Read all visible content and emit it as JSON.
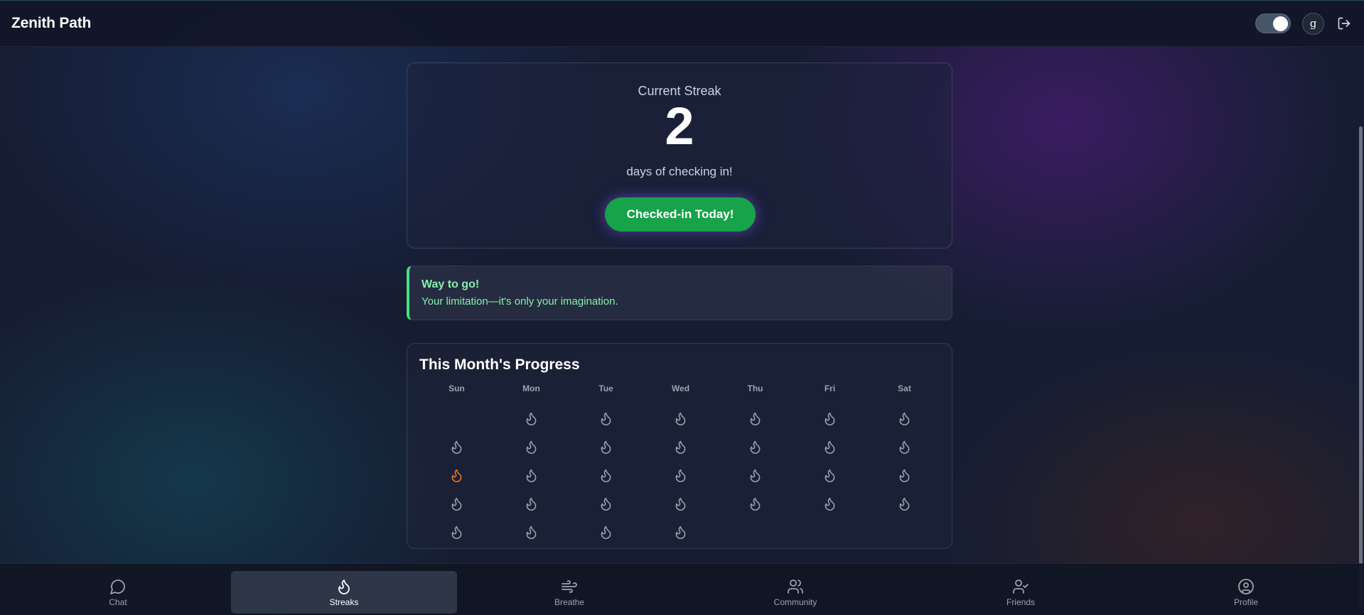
{
  "app": {
    "title": "Zenith Path"
  },
  "header": {
    "avatar_letter": "g",
    "theme_toggle": "on"
  },
  "streak": {
    "label": "Current Streak",
    "count": "2",
    "subtitle": "days of checking in!",
    "button_label": "Checked-in Today!"
  },
  "motivation": {
    "title": "Way to go!",
    "text": "Your limitation—it's only your imagination."
  },
  "progress": {
    "title": "This Month's Progress",
    "weekdays": [
      "Sun",
      "Mon",
      "Tue",
      "Wed",
      "Thu",
      "Fri",
      "Sat"
    ],
    "leading_blank_days": 1,
    "total_days": 31,
    "checked_in_days": [
      14
    ],
    "colors": {
      "inactive": "#9ca3af",
      "active": "#f97316"
    }
  },
  "nav": {
    "items": [
      {
        "label": "Chat",
        "icon": "chat-icon",
        "active": false
      },
      {
        "label": "Streaks",
        "icon": "flame-icon",
        "active": true
      },
      {
        "label": "Breathe",
        "icon": "wind-icon",
        "active": false
      },
      {
        "label": "Community",
        "icon": "users-icon",
        "active": false
      },
      {
        "label": "Friends",
        "icon": "user-check-icon",
        "active": false
      },
      {
        "label": "Profile",
        "icon": "user-circle-icon",
        "active": false
      }
    ]
  },
  "colors": {
    "accent_green": "#16a34a",
    "motivation_green": "#86efac",
    "streak_active": "#f97316"
  }
}
